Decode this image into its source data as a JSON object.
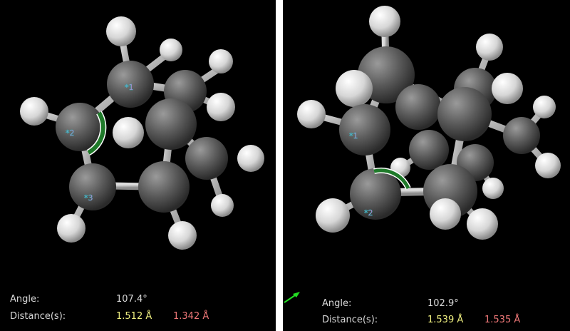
{
  "colors": {
    "background": "#000000",
    "carbon": "#5a5a5a",
    "hydrogen": "#e6e6e6",
    "bond": "#b8b8b8",
    "angle_arc": "#1f7a2a",
    "label_text": "#d8d8d8",
    "distance_1": "#f0f080",
    "distance_2": "#f07878",
    "atom_label_fill": "#ff66cc",
    "atom_label_stroke": "#20c0c0"
  },
  "left_view": {
    "angle_label": "Angle:",
    "angle_value": "107.4°",
    "distance_label": "Distance(s):",
    "distance_1": "1.512 Å",
    "distance_2": "1.342 Å",
    "atom_labels": [
      "*1",
      "*2",
      "*3"
    ]
  },
  "right_view": {
    "angle_label": "Angle:",
    "angle_value": "102.9°",
    "distance_label": "Distance(s):",
    "distance_1": "1.539 Å",
    "distance_2": "1.535 Å",
    "atom_labels": [
      "*1",
      "*2"
    ],
    "axis_icon": "green-axis-arrow-icon"
  }
}
